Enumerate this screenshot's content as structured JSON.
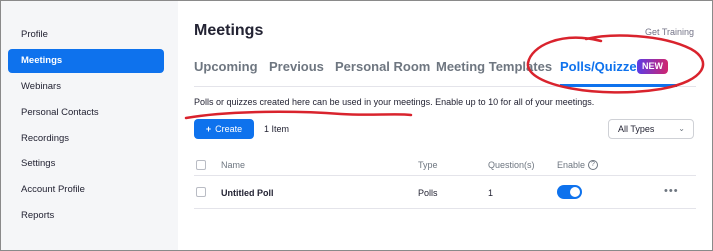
{
  "sidebar": {
    "items": [
      {
        "label": "Profile"
      },
      {
        "label": "Meetings"
      },
      {
        "label": "Webinars"
      },
      {
        "label": "Personal Contacts"
      },
      {
        "label": "Recordings"
      },
      {
        "label": "Settings"
      },
      {
        "label": "Account Profile"
      },
      {
        "label": "Reports"
      }
    ],
    "active_index": 1
  },
  "header": {
    "title": "Meetings",
    "training_link": "Get Training"
  },
  "tabs": [
    {
      "label": "Upcoming"
    },
    {
      "label": "Previous"
    },
    {
      "label": "Personal Room"
    },
    {
      "label": "Meeting Templates"
    },
    {
      "label": "Polls/Quizzes",
      "badge": "NEW"
    }
  ],
  "active_tab": "Polls/Quizzes",
  "description": "Polls or quizzes created here can be used in your meetings. Enable up to 10 for all of your meetings.",
  "toolbar": {
    "create_label": "Create",
    "item_count": "1 Item",
    "filter_value": "All Types"
  },
  "table": {
    "columns": [
      "Name",
      "Type",
      "Question(s)",
      "Enable"
    ],
    "rows": [
      {
        "name": "Untitled Poll",
        "type": "Polls",
        "questions": "1",
        "enabled": true
      }
    ]
  },
  "colors": {
    "accent": "#0e72ed",
    "annotation": "#d9232d"
  }
}
